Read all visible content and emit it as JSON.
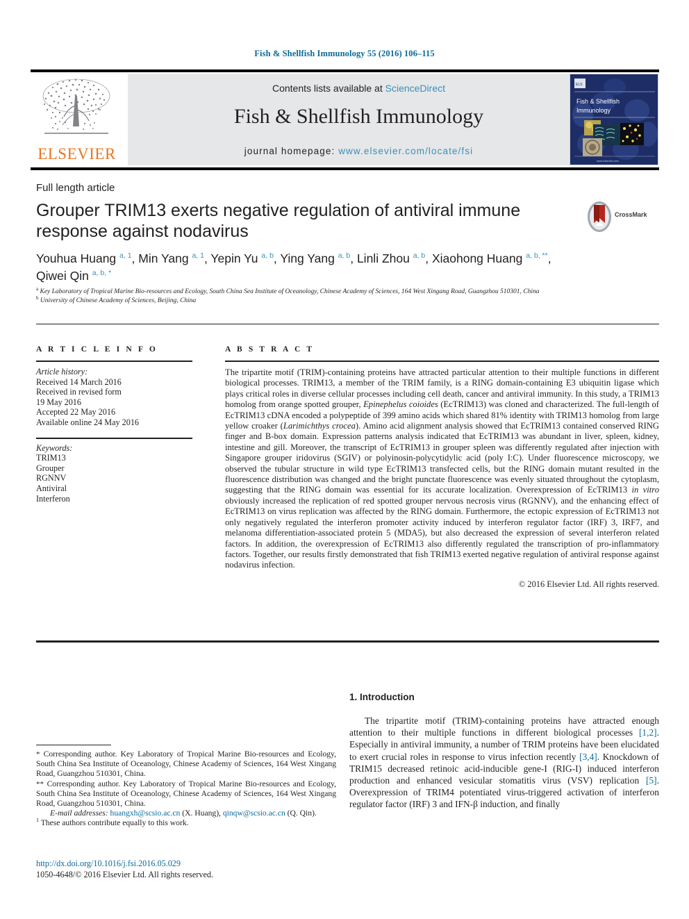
{
  "running_head": "Fish & Shellfish Immunology 55 (2016) 106–115",
  "masthead": {
    "contents_text": "Contents lists available at ",
    "sciencedirect": "ScienceDirect",
    "journal_title": "Fish & Shellfish Immunology",
    "homepage_label": "journal homepage: ",
    "homepage_url": "www.elsevier.com/locate/fsi",
    "publisher": "ELSEVIER",
    "cover_title_line1": "Fish & Shellfish",
    "cover_title_line2": "Immunology",
    "link_color": "#3a8fbd",
    "publisher_color": "#E87722"
  },
  "article": {
    "type": "Full length article",
    "title": "Grouper TRIM13 exerts negative regulation of antiviral immune response against nodavirus",
    "crossmark_label": "CrossMark"
  },
  "authors": {
    "list": [
      {
        "name": "Youhua Huang",
        "sup": "a, 1"
      },
      {
        "name": "Min Yang",
        "sup": "a, 1"
      },
      {
        "name": "Yepin Yu",
        "sup": "a, b"
      },
      {
        "name": "Ying Yang",
        "sup": "a, b"
      },
      {
        "name": "Linli Zhou",
        "sup": "a, b"
      },
      {
        "name": "Xiaohong Huang",
        "sup": "a, b, **"
      },
      {
        "name": "Qiwei Qin",
        "sup": "a, b, *"
      }
    ],
    "affiliations": [
      {
        "marker": "a",
        "text": "Key Laboratory of Tropical Marine Bio-resources and Ecology, South China Sea Institute of Oceanology, Chinese Academy of Sciences, 164 West Xingang Road, Guangzhou 510301, China"
      },
      {
        "marker": "b",
        "text": "University of Chinese Academy of Sciences, Beijing, China"
      }
    ]
  },
  "article_info": {
    "heading": "A R T I C L E   I N F O",
    "history_label": "Article history:",
    "history": [
      "Received 14 March 2016",
      "Received in revised form",
      "19 May 2016",
      "Accepted 22 May 2016",
      "Available online 24 May 2016"
    ],
    "keywords_label": "Keywords:",
    "keywords": [
      "TRIM13",
      "Grouper",
      "RGNNV",
      "Antiviral",
      "Interferon"
    ]
  },
  "abstract": {
    "heading": "A B S T R A C T",
    "part1": "The tripartite motif (TRIM)-containing proteins have attracted particular attention to their multiple functions in different biological processes. TRIM13, a member of the TRIM family, is a RING domain-containing E3 ubiquitin ligase which plays critical roles in diverse cellular processes including cell death, cancer and antiviral immunity. In this study, a TRIM13 homolog from orange spotted grouper, ",
    "italic1": "Epinephelus coioides",
    "part2": " (EcTRIM13) was cloned and characterized. The full-length of EcTRIM13 cDNA encoded a polypeptide of 399 amino acids which shared 81% identity with TRIM13 homolog from large yellow croaker (",
    "italic2": "Larimichthys crocea",
    "part3": "). Amino acid alignment analysis showed that EcTRIM13 contained conserved RING finger and B-box domain. Expression patterns analysis indicated that EcTRIM13 was abundant in liver, spleen, kidney, intestine and gill. Moreover, the transcript of EcTRIM13 in grouper spleen was differently regulated after injection with Singapore grouper iridovirus (SGIV) or polyinosin-polycytidylic acid (poly I:C). Under fluorescence microscopy, we observed the tubular structure in wild type EcTRIM13 transfected cells, but the RING domain mutant resulted in the fluorescence distribution was changed and the bright punctate fluorescence was evenly situated throughout the cytoplasm, suggesting that the RING domain was essential for its accurate localization. Overexpression of EcTRIM13 ",
    "italic3": "in vitro",
    "part4": " obviously increased the replication of red spotted grouper nervous necrosis virus (RGNNV), and the enhancing effect of EcTRIM13 on virus replication was affected by the RING domain. Furthermore, the ectopic expression of EcTRIM13 not only negatively regulated the interferon promoter activity induced by interferon regulator factor (IRF) 3, IRF7, and melanoma differentiation-associated protein 5 (MDA5), but also decreased the expression of several interferon related factors. In addition, the overexpression of EcTRIM13 also differently regulated the transcription of pro-inflammatory factors. Together, our results firstly demonstrated that fish TRIM13 exerted negative regulation of antiviral response against nodavirus infection.",
    "copyright": "© 2016 Elsevier Ltd. All rights reserved."
  },
  "introduction": {
    "heading": "1. Introduction",
    "p1_a": "The tripartite motif (TRIM)-containing proteins have attracted enough attention to their multiple functions in different biological processes ",
    "ref1": "[1,2]",
    "p1_b": ". Especially in antiviral immunity, a number of TRIM proteins have been elucidated to exert crucial roles in response to virus infection recently ",
    "ref2": "[3,4]",
    "p1_c": ". Knockdown of TRIM15 decreased retinoic acid-inducible gene-I (RIG-I) induced interferon production and enhanced vesicular stomatitis virus (VSV) replication ",
    "ref3": "[5]",
    "p1_d": ". Overexpression of TRIM4 potentiated virus-triggered activation of interferon regulator factor (IRF) 3 and IFN-β induction, and finally"
  },
  "footnotes": {
    "corr1_marker": "*",
    "corr1_text": " Corresponding author. Key Laboratory of Tropical Marine Bio-resources and Ecology, South China Sea Institute of Oceanology, Chinese Academy of Sciences, 164 West Xingang Road, Guangzhou 510301, China.",
    "corr2_marker": "**",
    "corr2_text": " Corresponding author. Key Laboratory of Tropical Marine Bio-resources and Ecology, South China Sea Institute of Oceanology, Chinese Academy of Sciences, 164 West Xingang Road, Guangzhou 510301, China.",
    "email_label": "E-mail addresses:",
    "email1": "huangxh@scsio.ac.cn",
    "email1_owner": " (X. Huang), ",
    "email2": "qinqw@scsio.ac.cn",
    "email2_owner": " (Q. Qin).",
    "equal_marker": "1",
    "equal_text": " These authors contribute equally to this work.",
    "doi": "http://dx.doi.org/10.1016/j.fsi.2016.05.029",
    "issn_line": "1050-4648/© 2016 Elsevier Ltd. All rights reserved."
  }
}
